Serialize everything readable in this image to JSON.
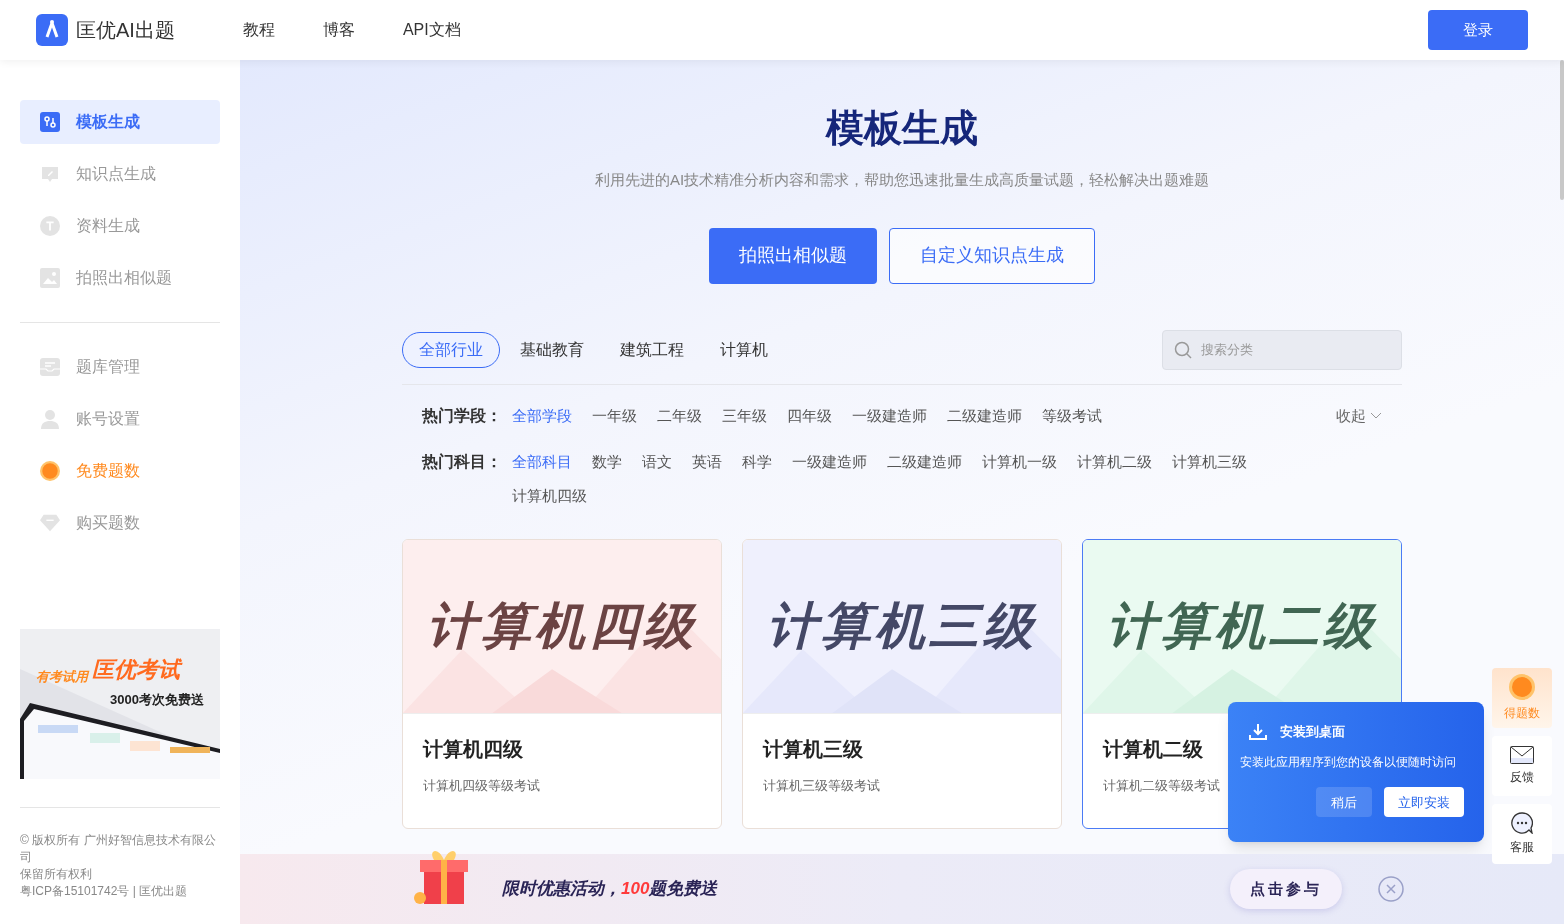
{
  "header": {
    "brand": "匡优AI出题",
    "nav": [
      "教程",
      "博客",
      "API文档"
    ],
    "login": "登录"
  },
  "sidebar": {
    "groups": [
      [
        {
          "label": "模板生成",
          "kind": "nav",
          "selected": true
        },
        {
          "label": "知识点生成",
          "kind": "nav",
          "selected": false
        },
        {
          "label": "资料生成",
          "kind": "nav",
          "selected": false
        },
        {
          "label": "拍照出相似题",
          "kind": "nav",
          "selected": false
        }
      ],
      [
        {
          "label": "题库管理",
          "kind": "nav",
          "selected": false
        },
        {
          "label": "账号设置",
          "kind": "nav",
          "selected": false
        },
        {
          "label": "免费题数",
          "kind": "promo",
          "selected": false
        },
        {
          "label": "购买题数",
          "kind": "nav",
          "selected": false
        }
      ]
    ],
    "banner": {
      "tagline": "有考试用",
      "brand": "匡优考试",
      "offer": "3000考次免费送"
    },
    "footer": [
      "© 版权所有 广州好智信息技术有限公司",
      "保留所有权利",
      "粤ICP备15101742号 | 匡优出题"
    ]
  },
  "hero": {
    "title": "模板生成",
    "subtitle": "利用先进的AI技术精准分析内容和需求，帮助您迅速批量生成高质量试题，轻松解决出题难题",
    "buttons": [
      {
        "label": "拍照出相似题",
        "kind": "primary"
      },
      {
        "label": "自定义知识点生成",
        "kind": "outline"
      }
    ]
  },
  "industry_tabs": [
    {
      "label": "全部行业",
      "selected": true
    },
    {
      "label": "基础教育",
      "selected": false
    },
    {
      "label": "建筑工程",
      "selected": false
    },
    {
      "label": "计算机",
      "selected": false
    }
  ],
  "search": {
    "placeholder": "搜索分类"
  },
  "filters": [
    {
      "label": "热门学段：",
      "options": [
        {
          "label": "全部学段",
          "selected": true
        },
        {
          "label": "一年级",
          "selected": false
        },
        {
          "label": "二年级",
          "selected": false
        },
        {
          "label": "三年级",
          "selected": false
        },
        {
          "label": "四年级",
          "selected": false
        },
        {
          "label": "一级建造师",
          "selected": false
        },
        {
          "label": "二级建造师",
          "selected": false
        },
        {
          "label": "等级考试",
          "selected": false
        }
      ]
    },
    {
      "label": "热门科目：",
      "options": [
        {
          "label": "全部科目",
          "selected": true
        },
        {
          "label": "数学",
          "selected": false
        },
        {
          "label": "语文",
          "selected": false
        },
        {
          "label": "英语",
          "selected": false
        },
        {
          "label": "科学",
          "selected": false
        },
        {
          "label": "一级建造师",
          "selected": false
        },
        {
          "label": "二级建造师",
          "selected": false
        },
        {
          "label": "计算机一级",
          "selected": false
        },
        {
          "label": "计算机二级",
          "selected": false
        },
        {
          "label": "计算机三级",
          "selected": false
        },
        {
          "label": "计算机四级",
          "selected": false
        }
      ]
    }
  ],
  "collapse": "收起",
  "cards": [
    {
      "art_title": "计算机四级",
      "title": "计算机四级",
      "description": "计算机四级等级考试",
      "color": "#6b4343",
      "selected": false
    },
    {
      "art_title": "计算机三级",
      "title": "计算机三级",
      "description": "计算机三级等级考试",
      "color": "#444866",
      "selected": false
    },
    {
      "art_title": "计算机二级",
      "title": "计算机二级",
      "description": "计算机二级等级考试",
      "color": "#416653",
      "selected": true
    }
  ],
  "install_popup": {
    "title": "安装到桌面",
    "message": "安装此应用程序到您的设备以便随时访问",
    "buttons": [
      {
        "label": "稍后",
        "kind": "secondary"
      },
      {
        "label": "立即安装",
        "kind": "primary"
      }
    ]
  },
  "side_tools": [
    {
      "label": "得题数",
      "kind": "ai"
    },
    {
      "label": "反馈",
      "kind": "mail"
    },
    {
      "label": "客服",
      "kind": "chat"
    }
  ],
  "promo_bar": {
    "before": "限时优惠活动，",
    "highlight": "100",
    "after": "题免费送",
    "action": "点击参与"
  }
}
